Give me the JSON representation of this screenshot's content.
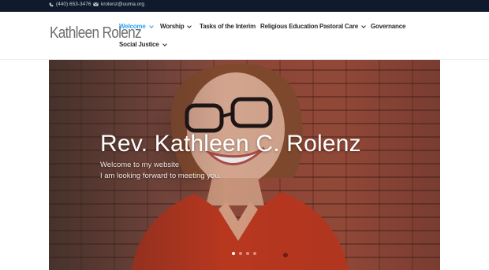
{
  "topbar": {
    "phone": "(440) 653-3476",
    "email": "krolenz@uuma.org",
    "phone_icon": "phone-icon",
    "email_icon": "envelope-icon"
  },
  "header": {
    "logo": "Kathleen Rolenz",
    "nav": [
      {
        "label": "Welcome",
        "has_dropdown": true,
        "active": true
      },
      {
        "label": "Worship",
        "has_dropdown": true,
        "active": false
      },
      {
        "label": "Tasks of the Interim",
        "has_dropdown": false,
        "active": false
      },
      {
        "label": "Religious Education",
        "has_dropdown": false,
        "active": false
      },
      {
        "label": "Pastoral Care",
        "has_dropdown": true,
        "active": false
      },
      {
        "label": "Governance",
        "has_dropdown": false,
        "active": false
      },
      {
        "label": "Social Justice",
        "has_dropdown": true,
        "active": false
      }
    ]
  },
  "hero": {
    "title": "Rev. Kathleen C. Rolenz",
    "subtitle_line1": "Welcome to my website",
    "subtitle_line2": "I am looking forward to meeting you.",
    "slide_count": 4,
    "active_slide": 1
  },
  "colors": {
    "topbar_bg": "#0f1b2d",
    "accent": "#2ea3f2",
    "nav_text": "#2b2b2b",
    "logo_text": "#6f6f6f"
  }
}
